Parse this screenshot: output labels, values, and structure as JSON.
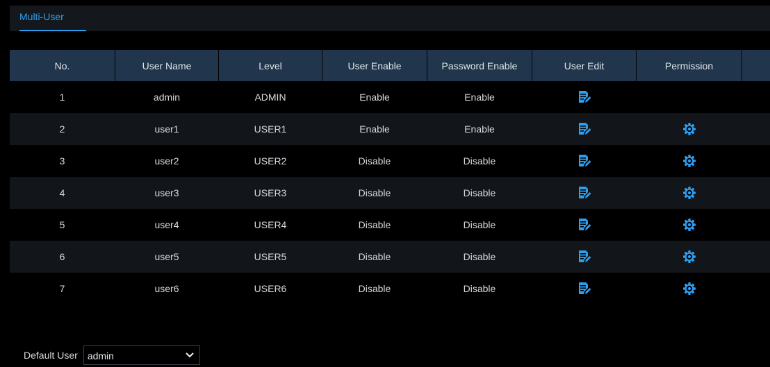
{
  "tabs": [
    {
      "label": "Multi-User",
      "active": true
    }
  ],
  "table": {
    "headers": [
      "No.",
      "User Name",
      "Level",
      "User Enable",
      "Password Enable",
      "User Edit",
      "Permission",
      ""
    ],
    "rows": [
      {
        "no": "1",
        "user_name": "admin",
        "level": "ADMIN",
        "user_enable": "Enable",
        "password_enable": "Enable",
        "user_edit_icon": "edit-icon",
        "permission_icon": ""
      },
      {
        "no": "2",
        "user_name": "user1",
        "level": "USER1",
        "user_enable": "Enable",
        "password_enable": "Enable",
        "user_edit_icon": "edit-icon",
        "permission_icon": "gear-icon"
      },
      {
        "no": "3",
        "user_name": "user2",
        "level": "USER2",
        "user_enable": "Disable",
        "password_enable": "Disable",
        "user_edit_icon": "edit-icon",
        "permission_icon": "gear-icon"
      },
      {
        "no": "4",
        "user_name": "user3",
        "level": "USER3",
        "user_enable": "Disable",
        "password_enable": "Disable",
        "user_edit_icon": "edit-icon",
        "permission_icon": "gear-icon"
      },
      {
        "no": "5",
        "user_name": "user4",
        "level": "USER4",
        "user_enable": "Disable",
        "password_enable": "Disable",
        "user_edit_icon": "edit-icon",
        "permission_icon": "gear-icon"
      },
      {
        "no": "6",
        "user_name": "user5",
        "level": "USER5",
        "user_enable": "Disable",
        "password_enable": "Disable",
        "user_edit_icon": "edit-icon",
        "permission_icon": "gear-icon"
      },
      {
        "no": "7",
        "user_name": "user6",
        "level": "USER6",
        "user_enable": "Disable",
        "password_enable": "Disable",
        "user_edit_icon": "edit-icon",
        "permission_icon": "gear-icon"
      }
    ]
  },
  "default_user": {
    "label": "Default User",
    "selected": "admin",
    "icon": "chevron-down-icon"
  },
  "colors": {
    "accent": "#2e9ef0",
    "header_bg": "#21364c",
    "row_alt_bg": "#121519",
    "background": "#000000",
    "text": "#d6d9dd"
  }
}
